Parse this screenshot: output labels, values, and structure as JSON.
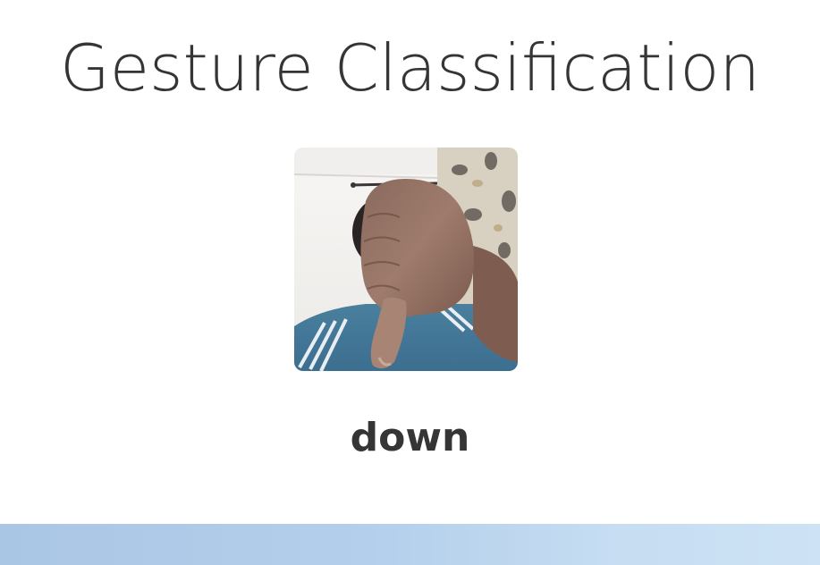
{
  "header": {
    "title": "Gesture Classification"
  },
  "webcam": {
    "icon": "webcam-feed-image",
    "description_hidden": true
  },
  "prediction": {
    "label": "down"
  },
  "colors": {
    "text": "#353535",
    "background": "#ffffff",
    "footer_start": "#aac6e5",
    "footer_end": "#cde2f4"
  }
}
